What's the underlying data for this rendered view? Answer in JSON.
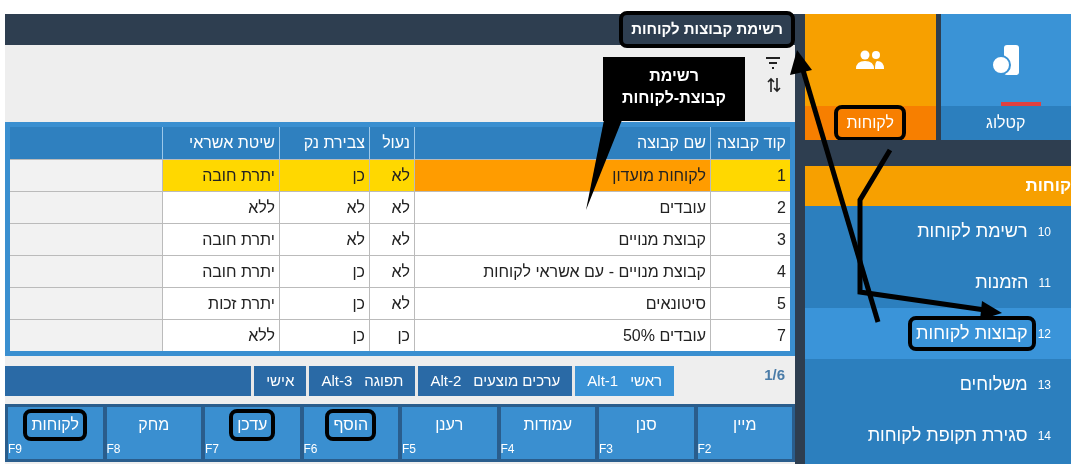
{
  "header": {
    "title": "רשימת קבוצות לקוחות",
    "highlighted": true
  },
  "callout": {
    "text": "רשימת\nקבוצת-לקוחות"
  },
  "table": {
    "columns": [
      "קוד קבוצה",
      "שם קבוצה",
      "נעול",
      "צבירת נק",
      "שיטת אשראי"
    ],
    "rows": [
      {
        "cells": [
          "1",
          "לקוחות מועדון",
          "לא",
          "כן",
          "יתרת חובה"
        ],
        "selected": true
      },
      {
        "cells": [
          "2",
          "עובדים",
          "לא",
          "לא",
          "ללא"
        ],
        "selected": false
      },
      {
        "cells": [
          "3",
          "קבוצת מנויים",
          "לא",
          "לא",
          "יתרת חובה"
        ],
        "selected": false
      },
      {
        "cells": [
          "4",
          "קבוצת מנויים - עם אשראי לקוחות",
          "לא",
          "כן",
          "יתרת חובה"
        ],
        "selected": false
      },
      {
        "cells": [
          "5",
          "סיטונאים",
          "לא",
          "כן",
          "יתרת זכות"
        ],
        "selected": false
      },
      {
        "cells": [
          "7",
          "עובדים 50%",
          "כן",
          "כן",
          "ללא"
        ],
        "selected": false
      }
    ]
  },
  "page_indicator": "1/6",
  "tabs": [
    {
      "label": "ראשי",
      "key": "Alt-1",
      "selected": true
    },
    {
      "label": "ערכים מוצעים",
      "key": "Alt-2",
      "selected": false
    },
    {
      "label": "תפוגה",
      "key": "Alt-3",
      "selected": false
    },
    {
      "label": "אישי",
      "selected": false
    }
  ],
  "function_keys": [
    {
      "label": "מיין",
      "key": "F2",
      "highlighted": false
    },
    {
      "label": "סנן",
      "key": "F3",
      "highlighted": false
    },
    {
      "label": "עמודות",
      "key": "F4",
      "highlighted": false
    },
    {
      "label": "רענן",
      "key": "F5",
      "highlighted": false
    },
    {
      "label": "הוסף",
      "key": "F6",
      "highlighted": true
    },
    {
      "label": "עדכן",
      "key": "F7",
      "highlighted": true
    },
    {
      "label": "מחק",
      "key": "F8",
      "highlighted": false
    },
    {
      "label": "לקוחות",
      "key": "F9",
      "highlighted": true
    }
  ],
  "sidebar": {
    "tiles": [
      {
        "kind": "catalog",
        "label": "קטלוג",
        "selected": false,
        "highlighted": false
      },
      {
        "kind": "people",
        "label": "לקוחות",
        "selected": true,
        "highlighted": true
      }
    ],
    "section": "קוחות",
    "items": [
      {
        "number": "10",
        "label": "רשימת לקוחות",
        "selected": false,
        "highlighted": false
      },
      {
        "number": "11",
        "label": "הזמנות",
        "selected": false,
        "highlighted": false
      },
      {
        "number": "12",
        "label": "קבוצות לקוחות",
        "selected": true,
        "highlighted": true
      },
      {
        "number": "13",
        "label": "משלוחים",
        "selected": false,
        "highlighted": false
      },
      {
        "number": "14",
        "label": "סגירת תקופת לקוחות",
        "selected": false,
        "highlighted": false
      }
    ]
  }
}
